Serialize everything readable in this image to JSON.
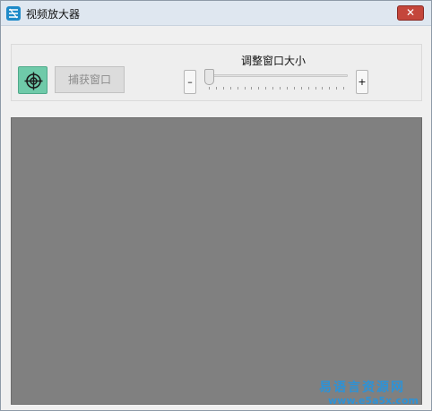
{
  "window": {
    "title": "视频放大器",
    "close_label": "✕"
  },
  "toolbar": {
    "capture_label": "捕获窗口",
    "resize_label": "调整窗口大小",
    "minus_label": "–",
    "plus_label": "+",
    "slider_value": 0.0,
    "crosshair_icon": "crosshair-target-icon",
    "accent_color": "#6fcaa9"
  },
  "viewport": {
    "background": "#808080"
  },
  "watermark": {
    "text": "易语言资源网",
    "url": "www.e5a5x.com"
  }
}
